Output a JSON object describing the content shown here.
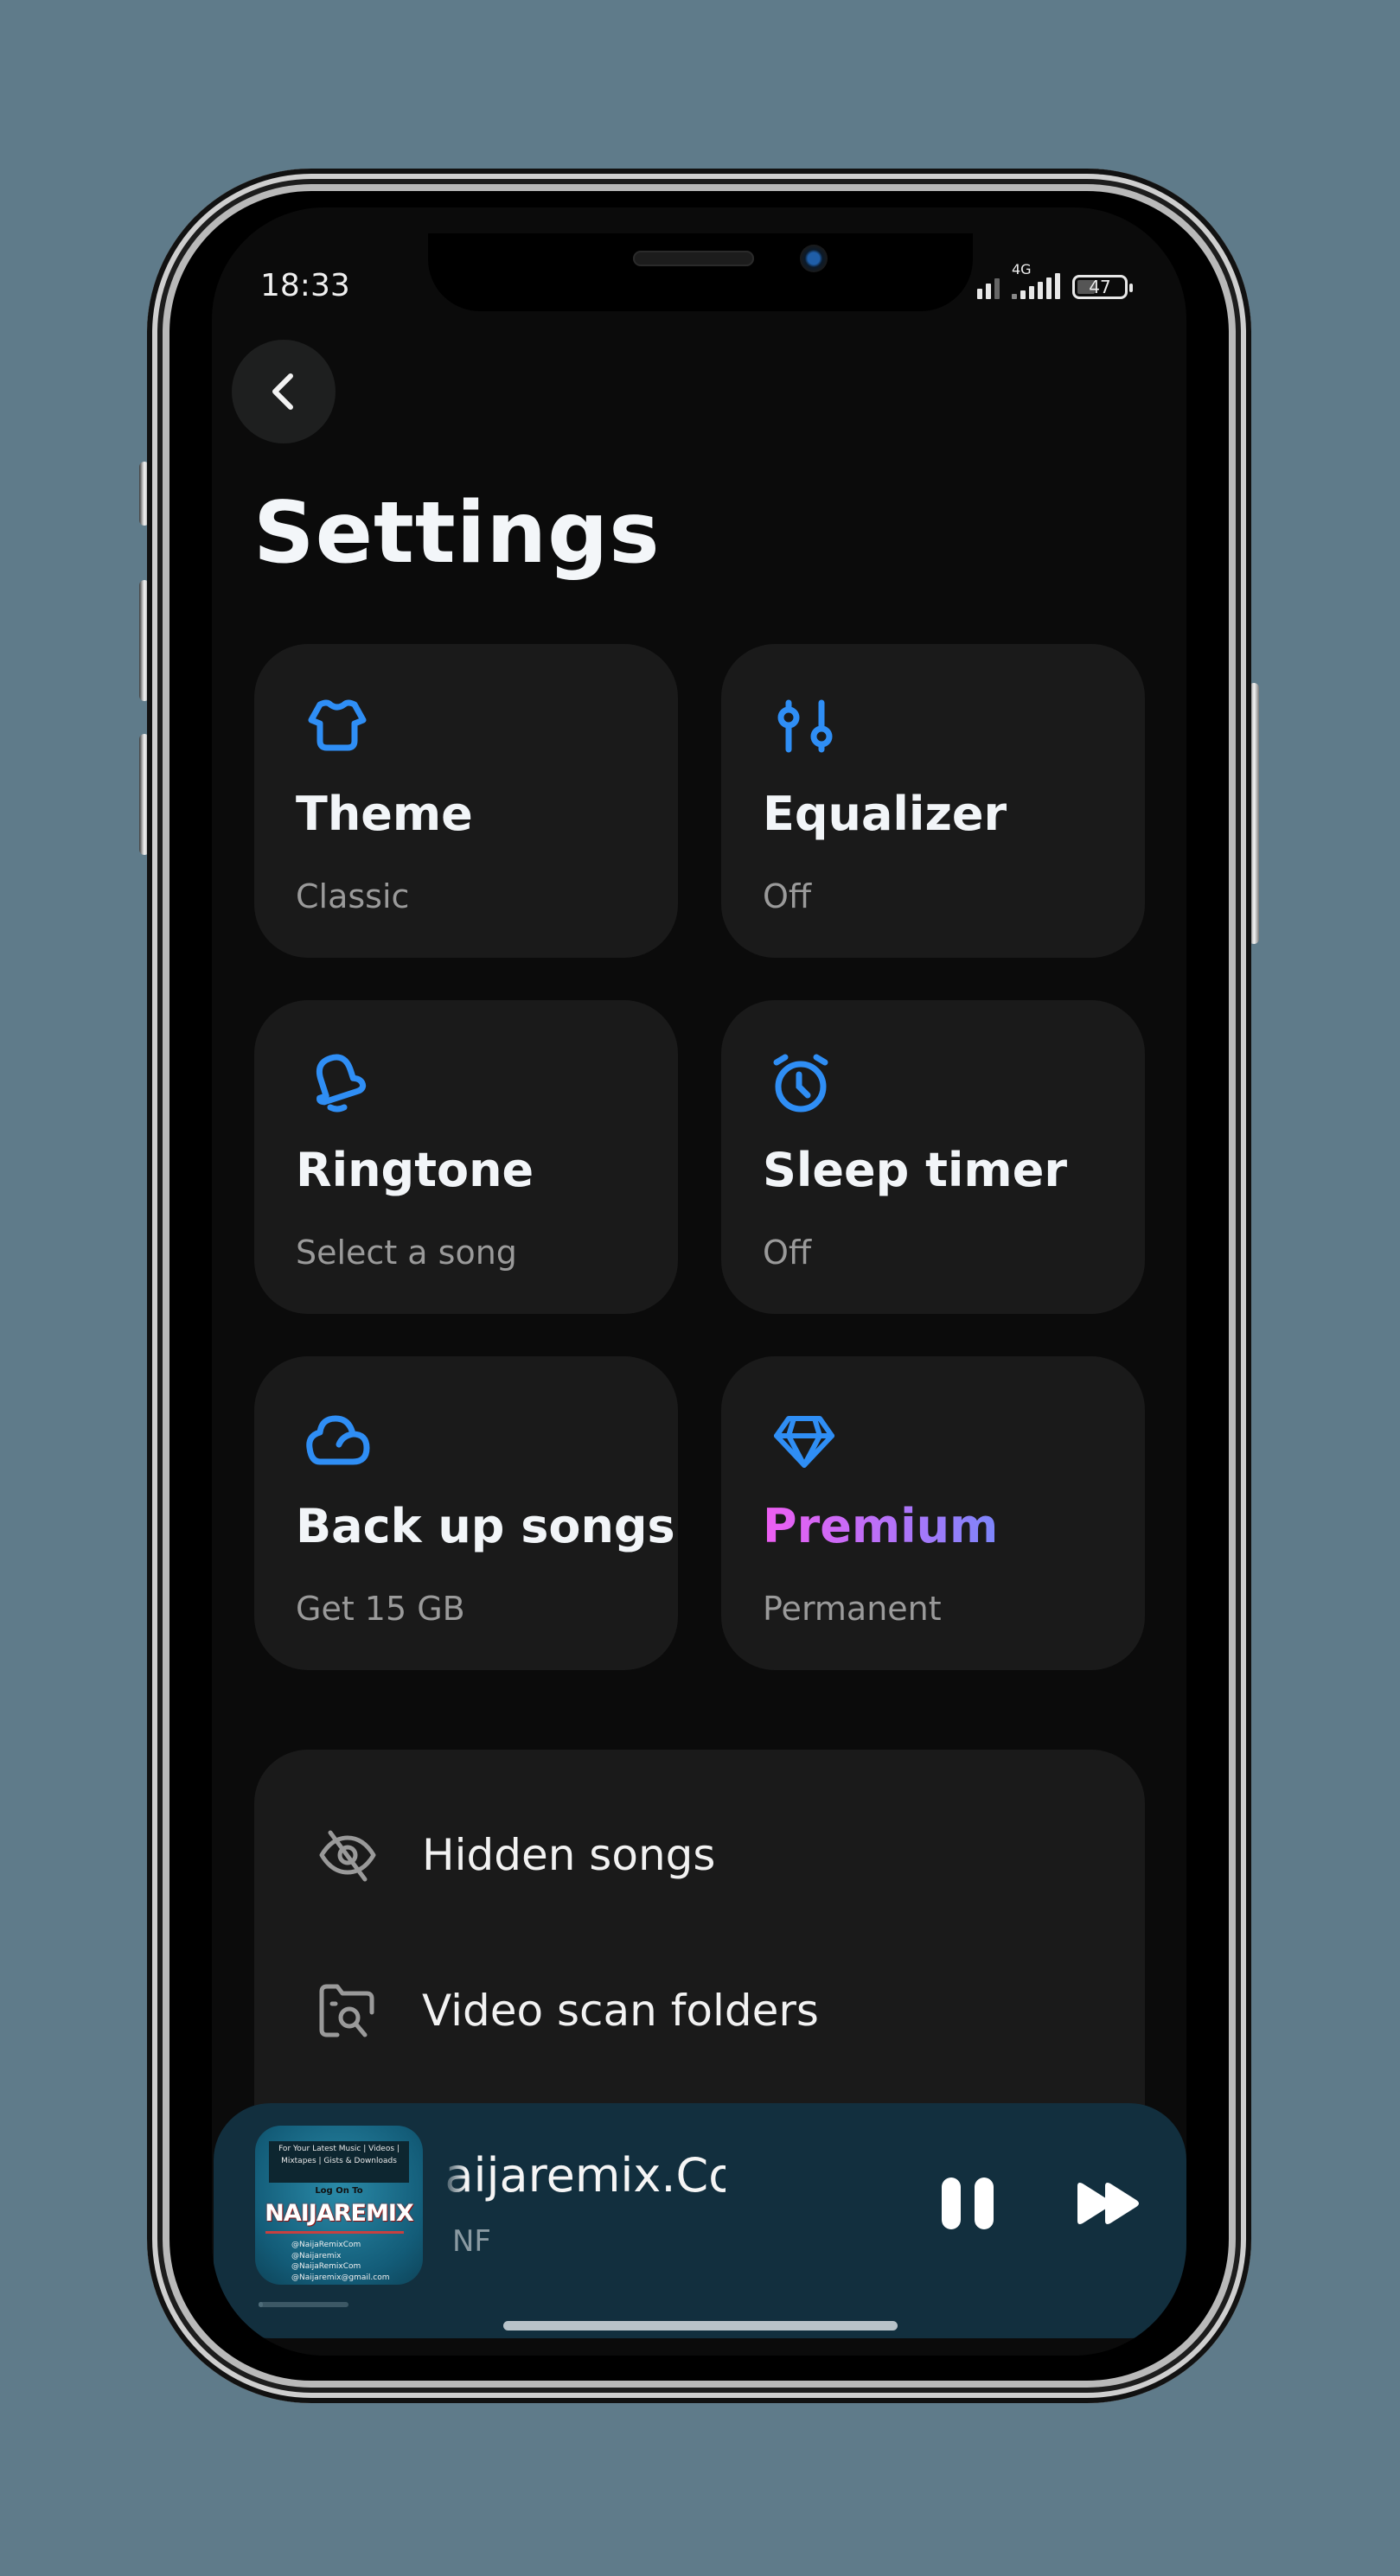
{
  "status_bar": {
    "time": "18:33",
    "network": "4G",
    "battery": "47"
  },
  "header": {
    "back_icon": "chevron-left-icon",
    "title": "Settings"
  },
  "colors": {
    "accent": "#2f8ef5",
    "card_bg": "#1a1a1a",
    "screen_bg": "#0b0b0b",
    "player_bg": "#122f3e",
    "premium_gradient_start": "#ee5ef2",
    "premium_gradient_end": "#7c86fb"
  },
  "cards": [
    {
      "icon": "tshirt-icon",
      "title": "Theme",
      "subtitle": "Classic"
    },
    {
      "icon": "equalizer-sliders-icon",
      "title": "Equalizer",
      "subtitle": "Off"
    },
    {
      "icon": "bell-icon",
      "title": "Ringtone",
      "subtitle": "Select a song"
    },
    {
      "icon": "alarm-clock-icon",
      "title": "Sleep timer",
      "subtitle": "Off"
    },
    {
      "icon": "cloud-icon",
      "title": "Back up songs",
      "subtitle": "Get 15 GB"
    },
    {
      "icon": "diamond-icon",
      "title": "Premium",
      "subtitle": "Permanent"
    }
  ],
  "list": [
    {
      "icon": "eye-off-icon",
      "label": "Hidden songs"
    },
    {
      "icon": "folder-search-icon",
      "label": "Video scan folders"
    }
  ],
  "mini_player": {
    "title": "Naijaremix.Com",
    "artist": "NF",
    "progress": 0.05,
    "album_art": {
      "banner": "For Your Latest Music | Videos | Mixtapes | Gists & Downloads",
      "log_on": "Log On To",
      "brand": "NAIJAREMIX",
      "handles": [
        "@NaijaRemixCom",
        "@Naijaremix",
        "@NaijaRemixCom",
        "@Naijaremix@gmail.com"
      ]
    },
    "pause_icon": "pause-icon",
    "next_icon": "fast-forward-icon"
  }
}
